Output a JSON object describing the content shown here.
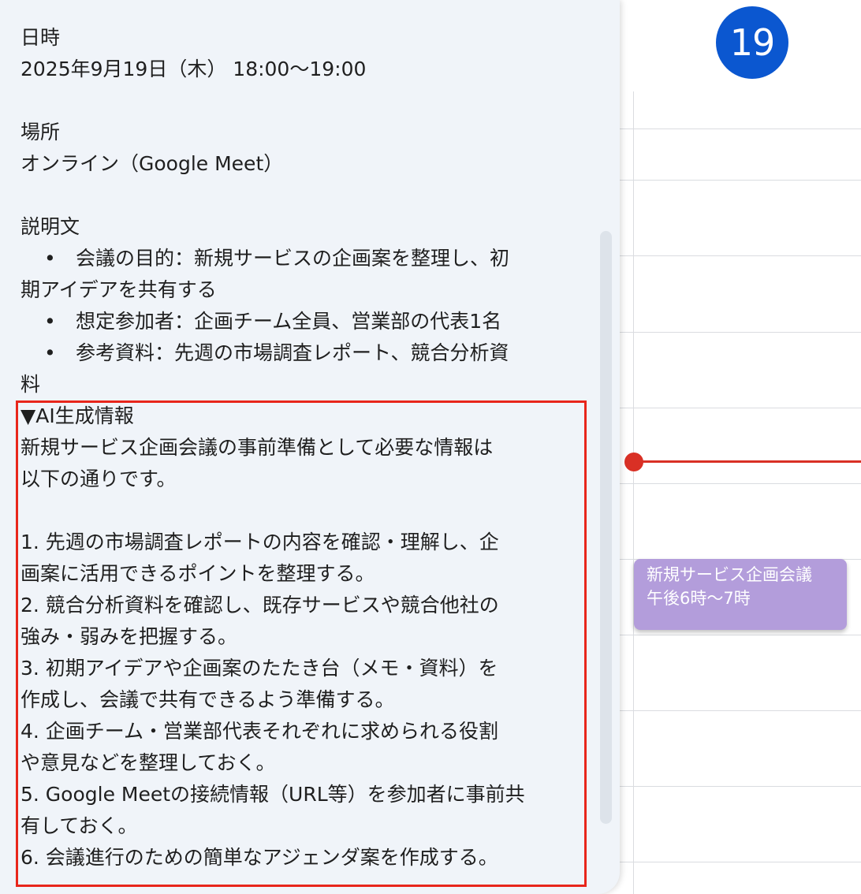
{
  "calendar": {
    "day_number": "19",
    "event": {
      "title": "新規サービス企画会議",
      "time": "午後6時〜7時"
    }
  },
  "details": {
    "datetime_label": "日時",
    "datetime_value": "2025年9月19日（木） 18:00〜19:00",
    "location_label": "場所",
    "location_value": "オンライン（Google Meet）",
    "description_label": "説明文",
    "bullet_char": "•",
    "description_lines": [
      "会議の目的：新規サービスの企画案を整理し、初",
      "期アイデアを共有する",
      "想定参加者：企画チーム全員、営業部の代表1名",
      "参考資料：先週の市場調査レポート、競合分析資",
      "料"
    ],
    "ai_section_header": "▼AI生成情報",
    "ai_lines": [
      "新規サービス企画会議の事前準備として必要な情報は",
      "以下の通りです。",
      "",
      "1. 先週の市場調査レポートの内容を確認・理解し、企",
      "画案に活用できるポイントを整理する。",
      "2. 競合分析資料を確認し、既存サービスや競合他社の",
      "強み・弱みを把握する。",
      "3. 初期アイデアや企画案のたたき台（メモ・資料）を",
      "作成し、会議で共有できるよう準備する。",
      "4. 企画チーム・営業部代表それぞれに求められる役割",
      "や意見などを整理しておく。",
      "5. Google Meetの接続情報（URL等）を参加者に事前共",
      "有しておく。",
      "6. 会議進行のための簡単なアジェンダ案を作成する。"
    ]
  }
}
